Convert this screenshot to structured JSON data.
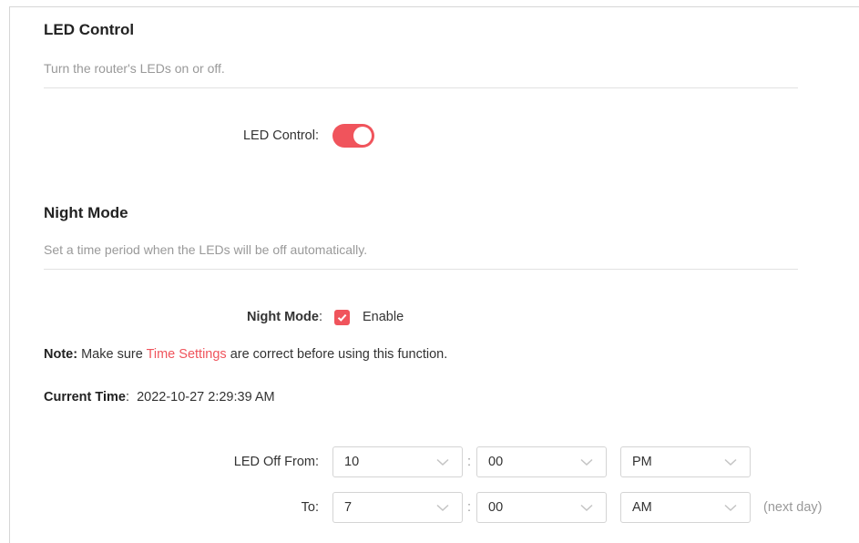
{
  "led_control": {
    "title": "LED Control",
    "description": "Turn the router's LEDs on or off.",
    "toggle_label": "LED Control:",
    "toggle_on": true
  },
  "night_mode": {
    "title": "Night Mode",
    "description": "Set a time period when the LEDs will be off automatically.",
    "checkbox_label": "Night Mode",
    "checkbox_suffix": ":",
    "enable_label": "Enable",
    "enabled": true,
    "note_prefix": "Note:",
    "note_before_link": " Make sure ",
    "note_link": "Time Settings",
    "note_after_link": " are correct before using this function.",
    "current_time_label": "Current Time",
    "current_time_sep": ":",
    "current_time_value": "2022-10-27 2:29:39 AM",
    "off_from_label": "LED Off From:",
    "to_label": "To:",
    "from": {
      "hour": "10",
      "minute": "00",
      "ampm": "PM"
    },
    "to": {
      "hour": "7",
      "minute": "00",
      "ampm": "AM"
    },
    "time_colon": ":",
    "next_day_hint": "(next day)"
  },
  "colors": {
    "accent": "#f0545c",
    "muted": "#999999",
    "text": "#333333"
  },
  "icons": [
    "check-icon",
    "chevron-down-icon"
  ]
}
